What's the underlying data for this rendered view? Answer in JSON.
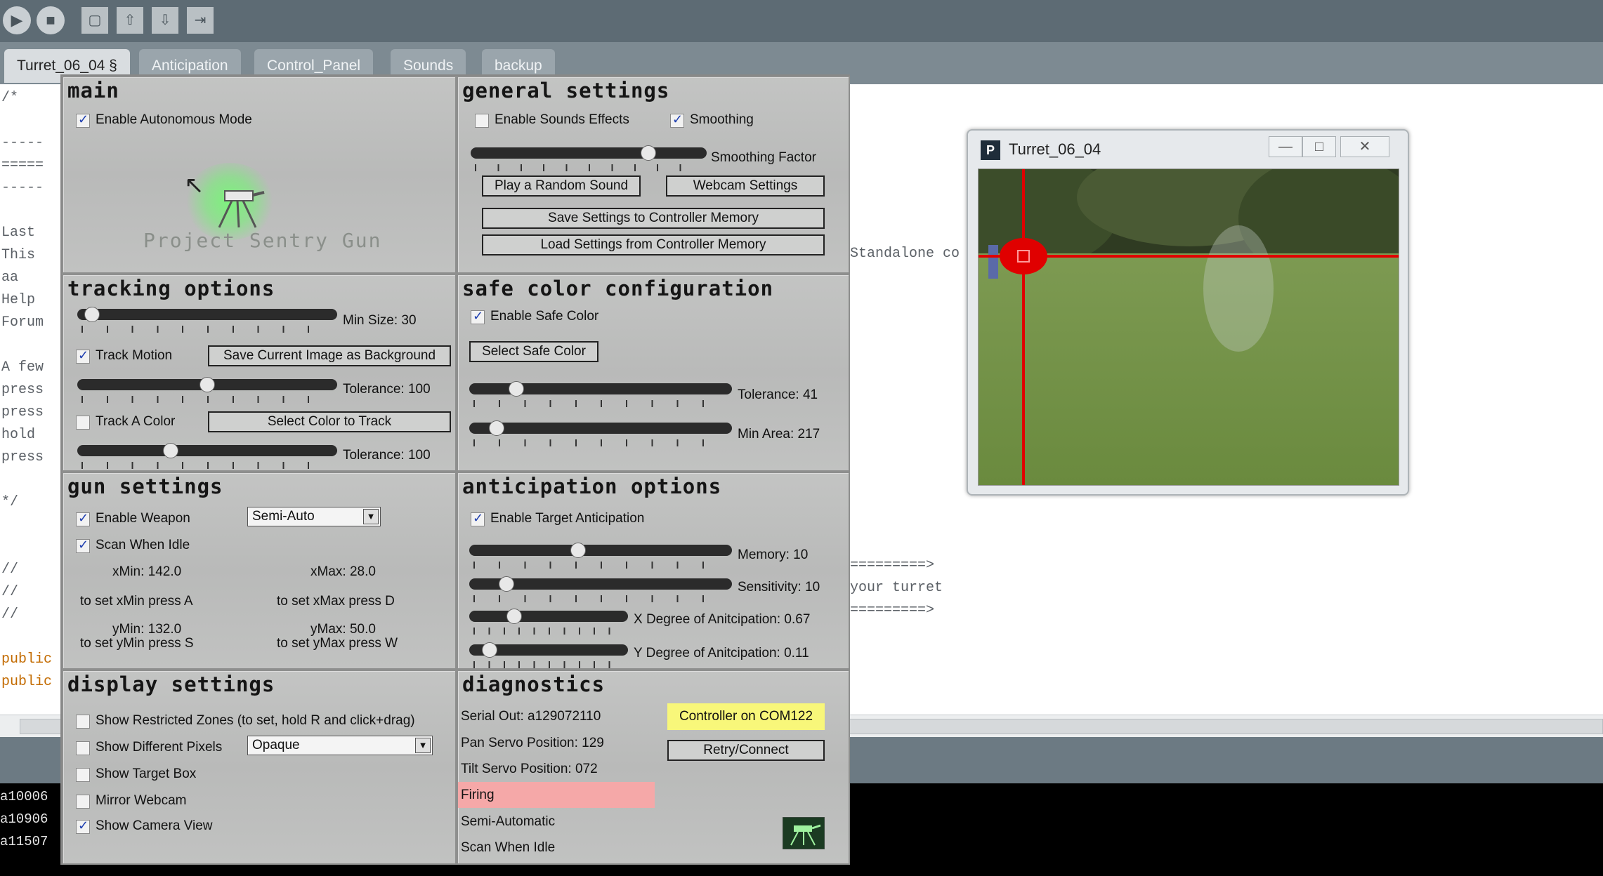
{
  "ide": {
    "tabs": [
      "Turret_06_04 §",
      "Anticipation",
      "Control_Panel",
      "Sounds",
      "backup"
    ],
    "code_lines": [
      {
        "text": "/*",
        "kw": false
      },
      {
        "text": "-----",
        "kw": false
      },
      {
        "text": "=====",
        "kw": false
      },
      {
        "text": "-----",
        "kw": false
      },
      {
        "text": "Last",
        "kw": false
      },
      {
        "text": "This",
        "kw": false
      },
      {
        "text": "aa",
        "kw": false
      },
      {
        "text": "Help",
        "kw": false
      },
      {
        "text": "Forum",
        "kw": false
      },
      {
        "text": "A few",
        "kw": false
      },
      {
        "text": "press",
        "kw": false
      },
      {
        "text": "press",
        "kw": false
      },
      {
        "text": "hold",
        "kw": false
      },
      {
        "text": "press",
        "kw": false
      },
      {
        "text": "*/",
        "kw": false
      },
      {
        "text": "//",
        "kw": false
      },
      {
        "text": "//",
        "kw": false
      },
      {
        "text": "//",
        "kw": false
      },
      {
        "text": "public",
        "kw": true
      },
      {
        "text": "public",
        "kw": true
      }
    ],
    "right_code": [
      "Standalone co",
      "=========>",
      "your turret",
      "=========>"
    ],
    "console_lines": [
      "a10006",
      "a10906",
      "a11507"
    ]
  },
  "camera_window": {
    "title": "Turret_06_04",
    "app_icon_letter": "P",
    "min_glyph": "—",
    "max_glyph": "□",
    "close_glyph": "✕"
  },
  "main": {
    "title": "main",
    "enable_autonomous": {
      "label": "Enable Autonomous Mode",
      "checked": true
    },
    "logo_text": "Project Sentry Gun"
  },
  "general": {
    "title": "general settings",
    "enable_sounds": {
      "label": "Enable Sounds Effects",
      "checked": false
    },
    "smoothing": {
      "label": "Smoothing",
      "checked": true
    },
    "smoothing_factor_label": "Smoothing Factor",
    "smoothing_value": 0.77,
    "play_random_sound": "Play a Random Sound",
    "webcam_settings": "Webcam Settings",
    "save_settings": "Save Settings to Controller Memory",
    "load_settings": "Load Settings from Controller Memory"
  },
  "tracking": {
    "title": "tracking options",
    "min_size_label": "Min Size: 30",
    "min_size_value": 0.03,
    "track_motion": {
      "label": "Track Motion",
      "checked": true
    },
    "save_background": "Save Current Image as Background",
    "motion_tolerance_label": "Tolerance: 100",
    "motion_tolerance_value": 0.5,
    "track_color": {
      "label": "Track A Color",
      "checked": false
    },
    "select_color": "Select Color to Track",
    "color_tolerance_label": "Tolerance: 100",
    "color_tolerance_value": 0.35
  },
  "safe_color": {
    "title": "safe color configuration",
    "enable": {
      "label": "Enable Safe Color",
      "checked": true
    },
    "select_button": "Select Safe Color",
    "tolerance_label": "Tolerance: 41",
    "tolerance_value": 0.16,
    "min_area_label": "Min Area: 217",
    "min_area_value": 0.08
  },
  "gun": {
    "title": "gun settings",
    "enable_weapon": {
      "label": "Enable Weapon",
      "checked": true
    },
    "mode": "Semi-Auto",
    "scan_idle": {
      "label": "Scan When Idle",
      "checked": true
    },
    "xmin": "xMin: 142.0",
    "xmax": "xMax: 28.0",
    "set_xmin": "to set xMin press A",
    "set_xmax": "to set xMax press D",
    "ymin": "yMin: 132.0",
    "ymax": "yMax: 50.0",
    "set_ymin": "to set yMin press S",
    "set_ymax": "to set yMax press W"
  },
  "anticipation": {
    "title": "anticipation options",
    "enable": {
      "label": "Enable Target Anticipation",
      "checked": true
    },
    "memory_label": "Memory: 10",
    "memory_value": 0.41,
    "sensitivity_label": "Sensitivity: 10",
    "sensitivity_value": 0.12,
    "x_degree_label": "X Degree of Anitcipation: 0.67",
    "x_degree_value": 0.26,
    "y_degree_label": "Y Degree of Anitcipation: 0.11",
    "y_degree_value": 0.09
  },
  "display": {
    "title": "display settings",
    "restricted_zones": {
      "label": "Show Restricted Zones  (to set, hold R and click+drag)",
      "checked": false
    },
    "different_pixels": {
      "label": "Show Different Pixels",
      "checked": false
    },
    "pixel_mode": "Opaque",
    "target_box": {
      "label": "Show Target Box",
      "checked": false
    },
    "mirror_webcam": {
      "label": "Mirror Webcam",
      "checked": false
    },
    "camera_view": {
      "label": "Show Camera View",
      "checked": true
    }
  },
  "diagnostics": {
    "title": "diagnostics",
    "serial_out": "Serial Out: a129072110",
    "pan_servo": "Pan Servo Position: 129",
    "tilt_servo": "Tilt Servo Position: 072",
    "firing": "Firing",
    "semi_auto": "Semi-Automatic",
    "scan_idle": "Scan When Idle",
    "controller_status": "Controller on COM122",
    "retry_connect": "Retry/Connect"
  },
  "colors": {
    "firing_bg": "#f5a8a8",
    "status_yellow": "#f8f77a",
    "crosshair_red": "#e00000",
    "keyword_orange": "#c36b00"
  }
}
